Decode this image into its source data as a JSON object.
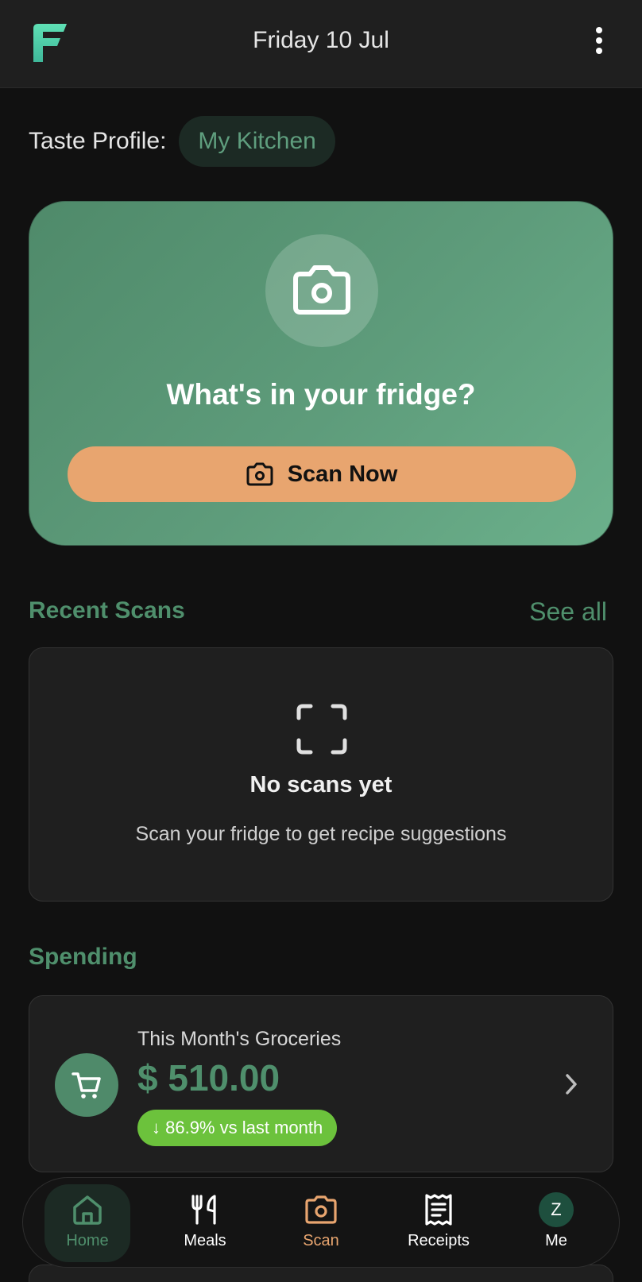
{
  "header": {
    "date": "Friday 10 Jul",
    "logo_icon": "app-logo-icon",
    "menu_icon": "kebab-menu-icon"
  },
  "taste_profile": {
    "label": "Taste Profile:",
    "value": "My Kitchen"
  },
  "hero": {
    "icon": "camera-icon",
    "title": "What's in your fridge?",
    "button_label": "Scan Now"
  },
  "recent_scans": {
    "heading": "Recent Scans",
    "see_all": "See all",
    "empty_icon": "scan-frame-icon",
    "empty_title": "No scans yet",
    "empty_subtitle": "Scan your fridge to get recipe suggestions"
  },
  "spending": {
    "heading": "Spending",
    "icon": "cart-icon",
    "label": "This Month's Groceries",
    "amount": "$ 510.00",
    "change": "↓ 86.9% vs last month"
  },
  "nav": {
    "items": [
      {
        "label": "Home",
        "icon": "home-icon",
        "active": true
      },
      {
        "label": "Meals",
        "icon": "fork-knife-icon",
        "active": false
      },
      {
        "label": "Scan",
        "icon": "camera-icon",
        "active": false
      },
      {
        "label": "Receipts",
        "icon": "receipt-icon",
        "active": false
      },
      {
        "label": "Me",
        "icon": "avatar",
        "avatar_letter": "Z",
        "active": false
      }
    ]
  },
  "colors": {
    "accent_green": "#4f8f6c",
    "scan_orange": "#e8a56f",
    "badge_green": "#6cc23c",
    "background": "#111111"
  }
}
